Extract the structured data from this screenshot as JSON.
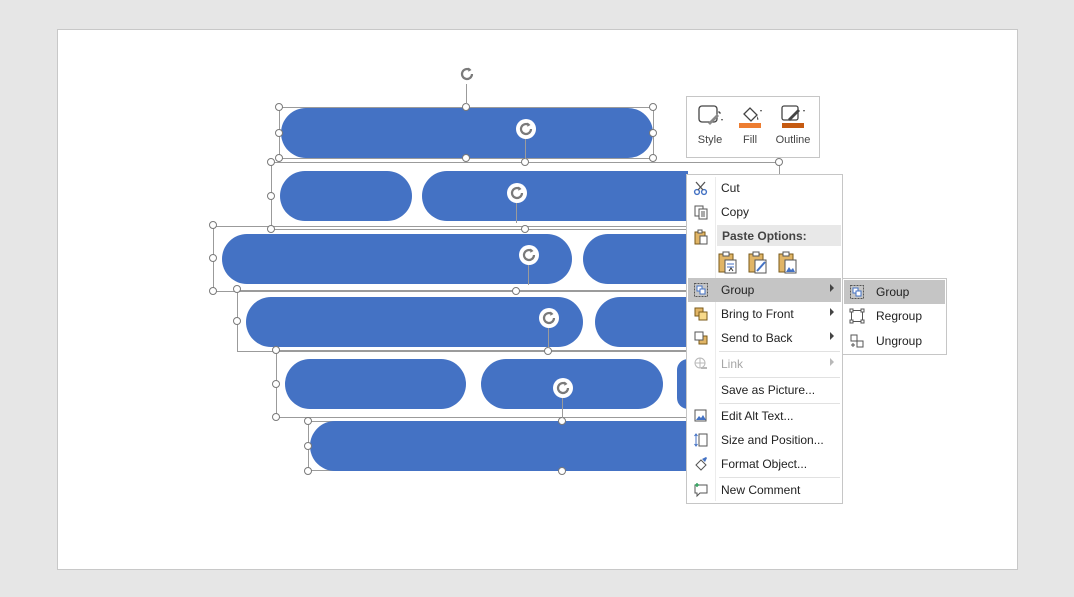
{
  "mini_toolbar": {
    "style_label": "Style",
    "fill_label": "Fill",
    "outline_label": "Outline",
    "fill_color": "#ed7d31",
    "outline_color": "#c55a11"
  },
  "context_menu": {
    "cut": "Cut",
    "copy": "Copy",
    "paste_options_header": "Paste Options:",
    "group": "Group",
    "bring_to_front": "Bring to Front",
    "send_to_back": "Send to Back",
    "link": "Link",
    "save_as_picture": "Save as Picture...",
    "edit_alt_text": "Edit Alt Text...",
    "size_and_position": "Size and Position...",
    "format_object": "Format Object...",
    "new_comment": "New Comment"
  },
  "group_submenu": {
    "group": "Group",
    "regroup": "Regroup",
    "ungroup": "Ungroup"
  },
  "colors": {
    "shape_fill": "#4472c4",
    "menu_highlight": "#c5c5c5"
  }
}
